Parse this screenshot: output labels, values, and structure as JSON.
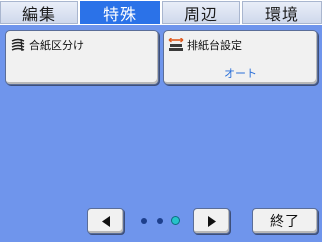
{
  "tabs": [
    {
      "label": "編集",
      "active": false
    },
    {
      "label": "特殊",
      "active": true
    },
    {
      "label": "周辺",
      "active": false
    },
    {
      "label": "環境",
      "active": false
    }
  ],
  "functions": {
    "insert_sheet": {
      "label": "合紙区分け",
      "icon": "stacked-sheets-icon"
    },
    "output_tray": {
      "label": "排紙台設定",
      "value": "オート",
      "icon": "output-tray-icon"
    }
  },
  "navigation": {
    "prev_icon": "triangle-left-icon",
    "next_icon": "triangle-right-icon",
    "page_count": 3,
    "current_page": 3,
    "end_label": "終了"
  },
  "colors": {
    "background": "#6f95ec",
    "active_tab": "#2b72e8",
    "value_text": "#2a6fd8",
    "current_page_dot": "#25c3c9"
  }
}
